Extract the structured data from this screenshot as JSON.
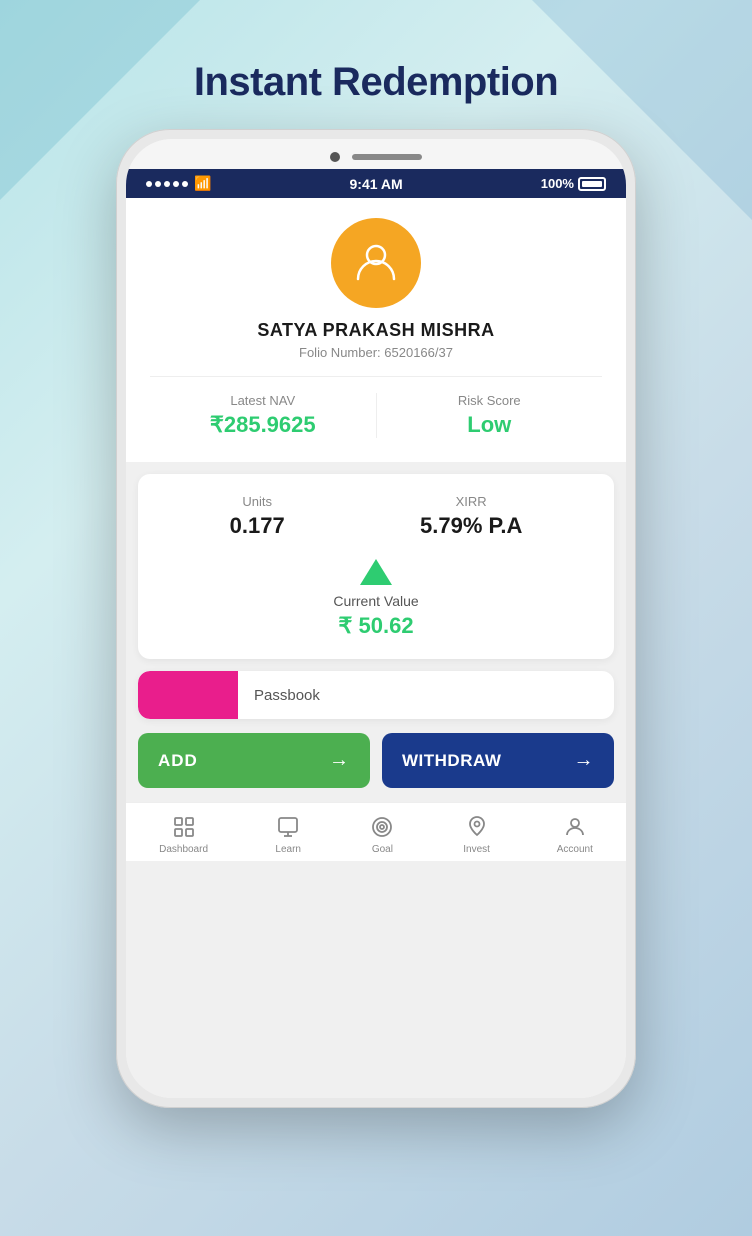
{
  "page": {
    "title": "Instant Redemption"
  },
  "status_bar": {
    "time": "9:41 AM",
    "battery": "100%"
  },
  "profile": {
    "name": "SATYA PRAKASH MISHRA",
    "folio_label": "Folio Number:",
    "folio_number": "6520166/37"
  },
  "stats": {
    "nav_label": "Latest NAV",
    "nav_value": "₹285.9625",
    "risk_label": "Risk Score",
    "risk_value": "Low"
  },
  "investment": {
    "units_label": "Units",
    "units_value": "0.177",
    "xirr_label": "XIRR",
    "xirr_value": "5.79% P.A",
    "cv_label": "Current Value",
    "cv_value": "₹ 50.62"
  },
  "passbook": {
    "label": "Passbook"
  },
  "buttons": {
    "add_label": "ADD",
    "withdraw_label": "WITHDRAW"
  },
  "bottom_nav": {
    "items": [
      {
        "label": "Dashboard",
        "icon": "dashboard-icon"
      },
      {
        "label": "Learn",
        "icon": "learn-icon"
      },
      {
        "label": "Goal",
        "icon": "goal-icon"
      },
      {
        "label": "Invest",
        "icon": "invest-icon"
      },
      {
        "label": "Account",
        "icon": "account-icon"
      }
    ]
  }
}
